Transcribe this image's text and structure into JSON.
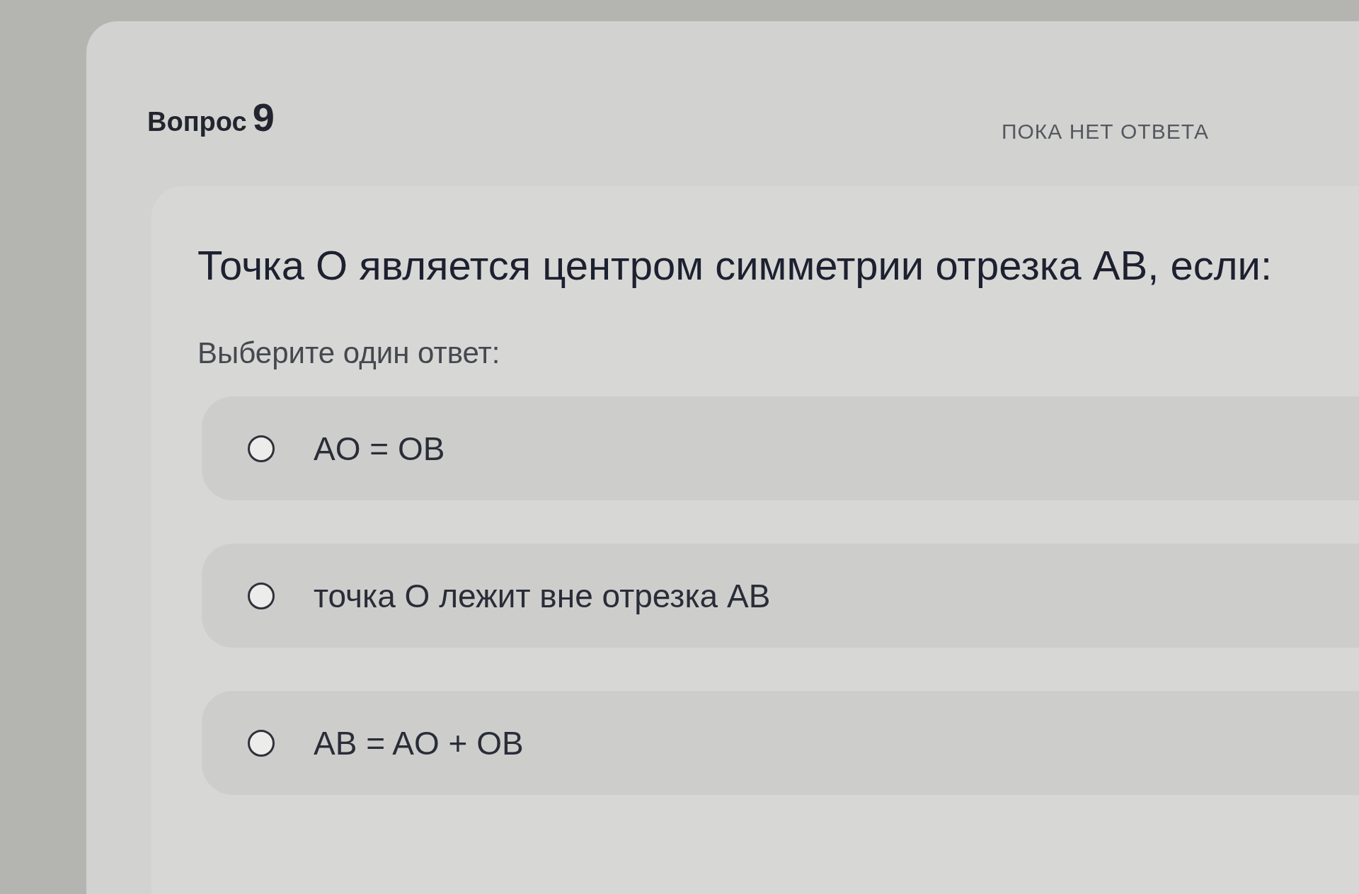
{
  "question": {
    "label": "Вопрос",
    "number": "9",
    "status": "ПОКА НЕТ ОТВЕТА"
  },
  "prompt": "Точка O является центром симметрии отрезка AB, если:",
  "instruction": "Выберите один ответ:",
  "options": [
    {
      "label": "AO = OB",
      "selected": false
    },
    {
      "label": "точка O лежит вне отрезка AB",
      "selected": false
    },
    {
      "label": "AB = AO + OB",
      "selected": false
    }
  ]
}
